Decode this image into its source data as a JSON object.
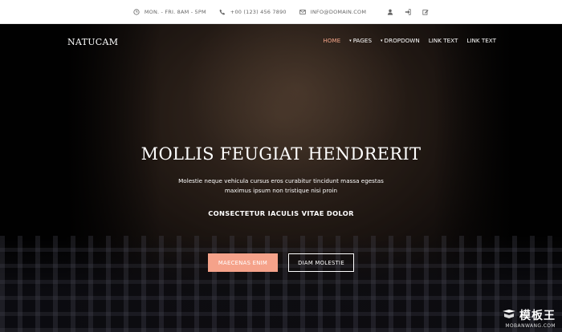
{
  "topbar": {
    "hours": "MON. - FRI. 8AM - 5PM",
    "phone": "+00 (123) 456 7890",
    "email": "INFO@DOMAIN.COM",
    "icons": [
      "user-icon",
      "sign-in-icon",
      "edit-icon"
    ]
  },
  "nav": {
    "brand": "NATUCAM",
    "items": [
      {
        "label": "HOME",
        "active": true,
        "caret": false
      },
      {
        "label": "PAGES",
        "active": false,
        "caret": true
      },
      {
        "label": "DROPDOWN",
        "active": false,
        "caret": true
      },
      {
        "label": "LINK TEXT",
        "active": false,
        "caret": false
      },
      {
        "label": "LINK TEXT",
        "active": false,
        "caret": false
      }
    ],
    "caret_glyph": "▾"
  },
  "hero": {
    "title": "MOLLIS FEUGIAT HENDRERIT",
    "subtitle_line1": "Molestie neque vehicula cursus eros curabitur tincidunt massa egestas",
    "subtitle_line2": "maximus ipsum non tristique nisi proin",
    "strapline": "CONSECTETUR IACULIS VITAE DOLOR",
    "primary_button": "MAECENAS ENIM",
    "secondary_button": "DIAM MOLESTIE"
  },
  "watermark": {
    "logo": "模板王",
    "url": "MOBANWANG.COM"
  },
  "colors": {
    "accent": "#f5a28a",
    "topbar_bg": "#ffffff",
    "hero_text": "#ffffff"
  }
}
